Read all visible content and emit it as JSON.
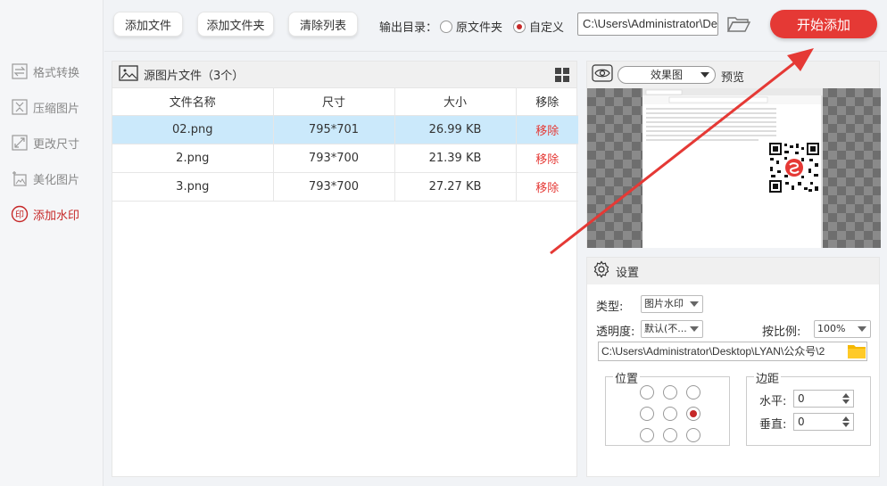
{
  "sidebar": {
    "items": [
      {
        "label": "格式转换",
        "icon": "convert-icon",
        "active": false
      },
      {
        "label": "压缩图片",
        "icon": "compress-icon",
        "active": false
      },
      {
        "label": "更改尺寸",
        "icon": "resize-icon",
        "active": false
      },
      {
        "label": "美化图片",
        "icon": "beautify-icon",
        "active": false
      },
      {
        "label": "添加水印",
        "icon": "watermark-icon",
        "active": true
      }
    ]
  },
  "toolbar": {
    "add_file": "添加文件",
    "add_folder": "添加文件夹",
    "clear_list": "清除列表",
    "output_label": "输出目录：",
    "radio_original": "原文件夹",
    "radio_custom": "自定义",
    "selected_output": "自定义",
    "output_path": "C:\\Users\\Administrator\\Desktop\\LYAN",
    "start": "开始添加"
  },
  "files": {
    "title": "源图片文件（3个）",
    "columns": [
      "文件名称",
      "尺寸",
      "大小",
      "移除"
    ],
    "rows": [
      {
        "name": "02.png",
        "size": "795*701",
        "filesize": "26.99 KB",
        "remove": "移除",
        "selected": true
      },
      {
        "name": "2.png",
        "size": "793*700",
        "filesize": "21.39 KB",
        "remove": "移除",
        "selected": false
      },
      {
        "name": "3.png",
        "size": "793*700",
        "filesize": "27.27 KB",
        "remove": "移除",
        "selected": false
      }
    ]
  },
  "preview": {
    "mode": "效果图",
    "label": "预览"
  },
  "settings": {
    "title": "设置",
    "type_label": "类型:",
    "type_value": "图片水印",
    "opacity_label": "透明度:",
    "opacity_value": "默认(不...",
    "scale_label": "按比例:",
    "scale_value": "100%",
    "watermark_path": "C:\\Users\\Administrator\\Desktop\\LYAN\\公众号\\2",
    "position_label": "位置",
    "position_selected": "middle-right",
    "margin_label": "边距",
    "h_label": "水平:",
    "h_value": "0",
    "v_label": "垂直:",
    "v_value": "0"
  },
  "colors": {
    "accent": "#e53935",
    "active_sidebar": "#c62828",
    "row_selected": "#cbe9fb"
  }
}
